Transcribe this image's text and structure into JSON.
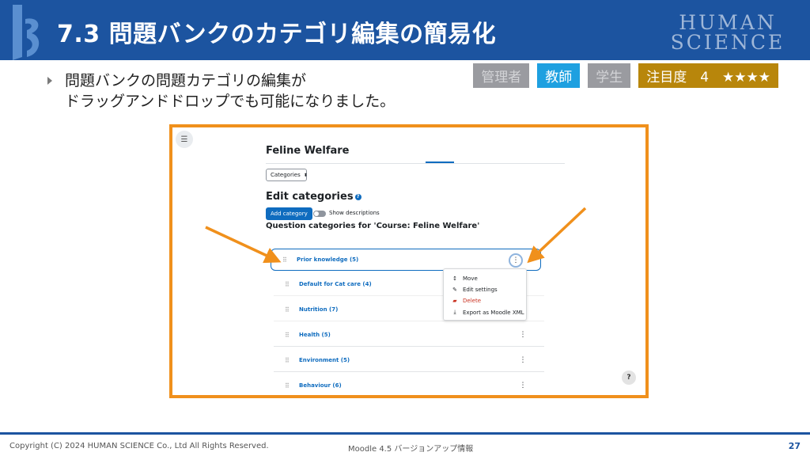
{
  "header": {
    "title": "7.3 問題バンクのカテゴリ編集の簡易化",
    "brand_line1": "HUMAN",
    "brand_line2": "SCIENCE",
    "color": "#1c54a0"
  },
  "bullet": {
    "line1": "問題バンクの問題カテゴリの編集が",
    "line2": "ドラッグアンドドロップでも可能になりました。"
  },
  "badges": {
    "admin": "管理者",
    "teacher": "教師",
    "student": "学生",
    "attention": "注目度　4　★★★★"
  },
  "screenshot": {
    "course_title": "Feline Welfare",
    "select_label": "Categories",
    "edit_heading": "Edit categories",
    "add_button": "Add category",
    "toggle_label": "Show descriptions",
    "qc_heading": "Question categories for 'Course: Feline Welfare'",
    "categories": [
      {
        "name": "Prior knowledge (5)"
      },
      {
        "name": "Default for Cat care (4)"
      },
      {
        "name": "Nutrition (7)"
      },
      {
        "name": "Health (5)"
      },
      {
        "name": "Environment (5)"
      },
      {
        "name": "Behaviour (6)"
      }
    ],
    "menu": {
      "move": "Move",
      "edit": "Edit settings",
      "delete": "Delete",
      "export": "Export as Moodle XML"
    },
    "help": "?"
  },
  "footer": {
    "copyright": "Copyright (C) 2024 HUMAN SCIENCE Co., Ltd All Rights Reserved.",
    "subtitle": "Moodle 4.5 バージョンアップ情報",
    "page": "27"
  }
}
